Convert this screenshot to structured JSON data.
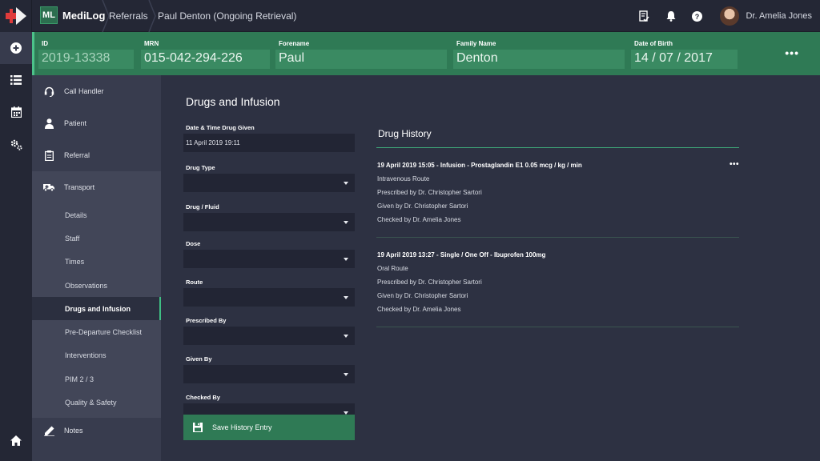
{
  "brand": {
    "badge": "ML",
    "name": "MediLog"
  },
  "breadcrumbs": [
    "Referrals",
    "Paul Denton (Ongoing Retrieval)"
  ],
  "user": {
    "name": "Dr. Amelia Jones"
  },
  "patient": {
    "id_label": "ID",
    "id_value": "2019-13338",
    "mrn_label": "MRN",
    "mrn_value": "015-042-294-226",
    "forename_label": "Forename",
    "forename_value": "Paul",
    "family_label": "Family Name",
    "family_value": "Denton",
    "dob_label": "Date of Birth",
    "dob_value": "14 / 07 / 2017",
    "more": "•••"
  },
  "nav": {
    "call_handler": "Call Handler",
    "patient": "Patient",
    "referral": "Referral",
    "transport": "Transport",
    "transport_items": [
      "Details",
      "Staff",
      "Times",
      "Observations",
      "Drugs and Infusion",
      "Pre-Departure Checklist",
      "Interventions",
      "PIM 2 / 3",
      "Quality & Safety"
    ],
    "notes": "Notes"
  },
  "page": {
    "title": "Drugs and Infusion"
  },
  "form": {
    "datetime_label": "Date & Time Drug Given",
    "datetime_value": "11 April 2019 19:11",
    "drug_type_label": "Drug Type",
    "drug_fluid_label": "Drug / Fluid",
    "dose_label": "Dose",
    "route_label": "Route",
    "prescribed_label": "Prescribed By",
    "given_label": "Given By",
    "checked_label": "Checked By",
    "save_label": "Save History Entry"
  },
  "history": {
    "title": "Drug History",
    "more": "•••",
    "entries": [
      {
        "heading": "19 April 2019 15:05 - Infusion - Prostaglandin E1 0.05 mcg / kg / min",
        "route": "Intravenous Route",
        "prescribed": "Prescribed by Dr. Christopher Sartori",
        "given": "Given by Dr. Christopher Sartori",
        "checked": "Checked by Dr. Amelia Jones"
      },
      {
        "heading": "19 April 2019 13:27 - Single / One Off - Ibuprofen 100mg",
        "route": "Oral Route",
        "prescribed": "Prescribed by Dr. Christopher Sartori",
        "given": "Given by Dr. Christopher Sartori",
        "checked": "Checked by Dr. Amelia Jones"
      }
    ]
  },
  "colors": {
    "accent": "#2f7a55",
    "accent_light": "#3fbf84",
    "bg": "#2d3142",
    "sidebar": "#383c4e"
  }
}
